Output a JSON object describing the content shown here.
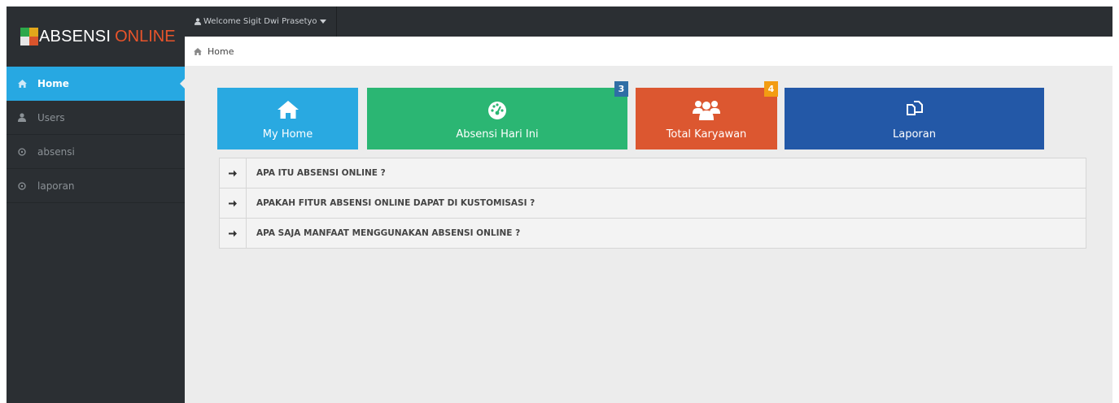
{
  "app": {
    "logo_main": "ABSENSI",
    "logo_accent": "ONLINE"
  },
  "topbar": {
    "welcome": "Welcome Sigit Dwi Prasetyo"
  },
  "breadcrumb": {
    "current": "Home"
  },
  "sidebar": {
    "items": [
      {
        "label": "Home",
        "icon": "home-icon",
        "active": true
      },
      {
        "label": "Users",
        "icon": "user-icon",
        "active": false
      },
      {
        "label": "absensi",
        "icon": "circle-icon",
        "active": false
      },
      {
        "label": "laporan",
        "icon": "circle-icon",
        "active": false
      }
    ]
  },
  "tiles": [
    {
      "label": "My Home",
      "icon": "home-icon",
      "color": "#29a9e1"
    },
    {
      "label": "Absensi Hari Ini",
      "icon": "dashboard-icon",
      "color": "#2bb673",
      "badge": "3"
    },
    {
      "label": "Total Karyawan",
      "icon": "group-icon",
      "color": "#dc5730",
      "badge": "4"
    },
    {
      "label": "Laporan",
      "icon": "copy-icon",
      "color": "#2358a7"
    }
  ],
  "faq": [
    {
      "title": "APA ITU ABSENSI ONLINE ?"
    },
    {
      "title": "APAKAH FITUR ABSENSI ONLINE DAPAT DI KUSTOMISASI ?"
    },
    {
      "title": "APA SAJA MANFAAT MENGGUNAKAN ABSENSI ONLINE ?"
    }
  ],
  "colors": {
    "sidebar_bg": "#2b2f33",
    "active_blue": "#27a8e2",
    "content_bg": "#ececec",
    "logo_accent": "#e8542b",
    "badge_blue": "#2f6ea5",
    "badge_orange": "#f39c12"
  }
}
